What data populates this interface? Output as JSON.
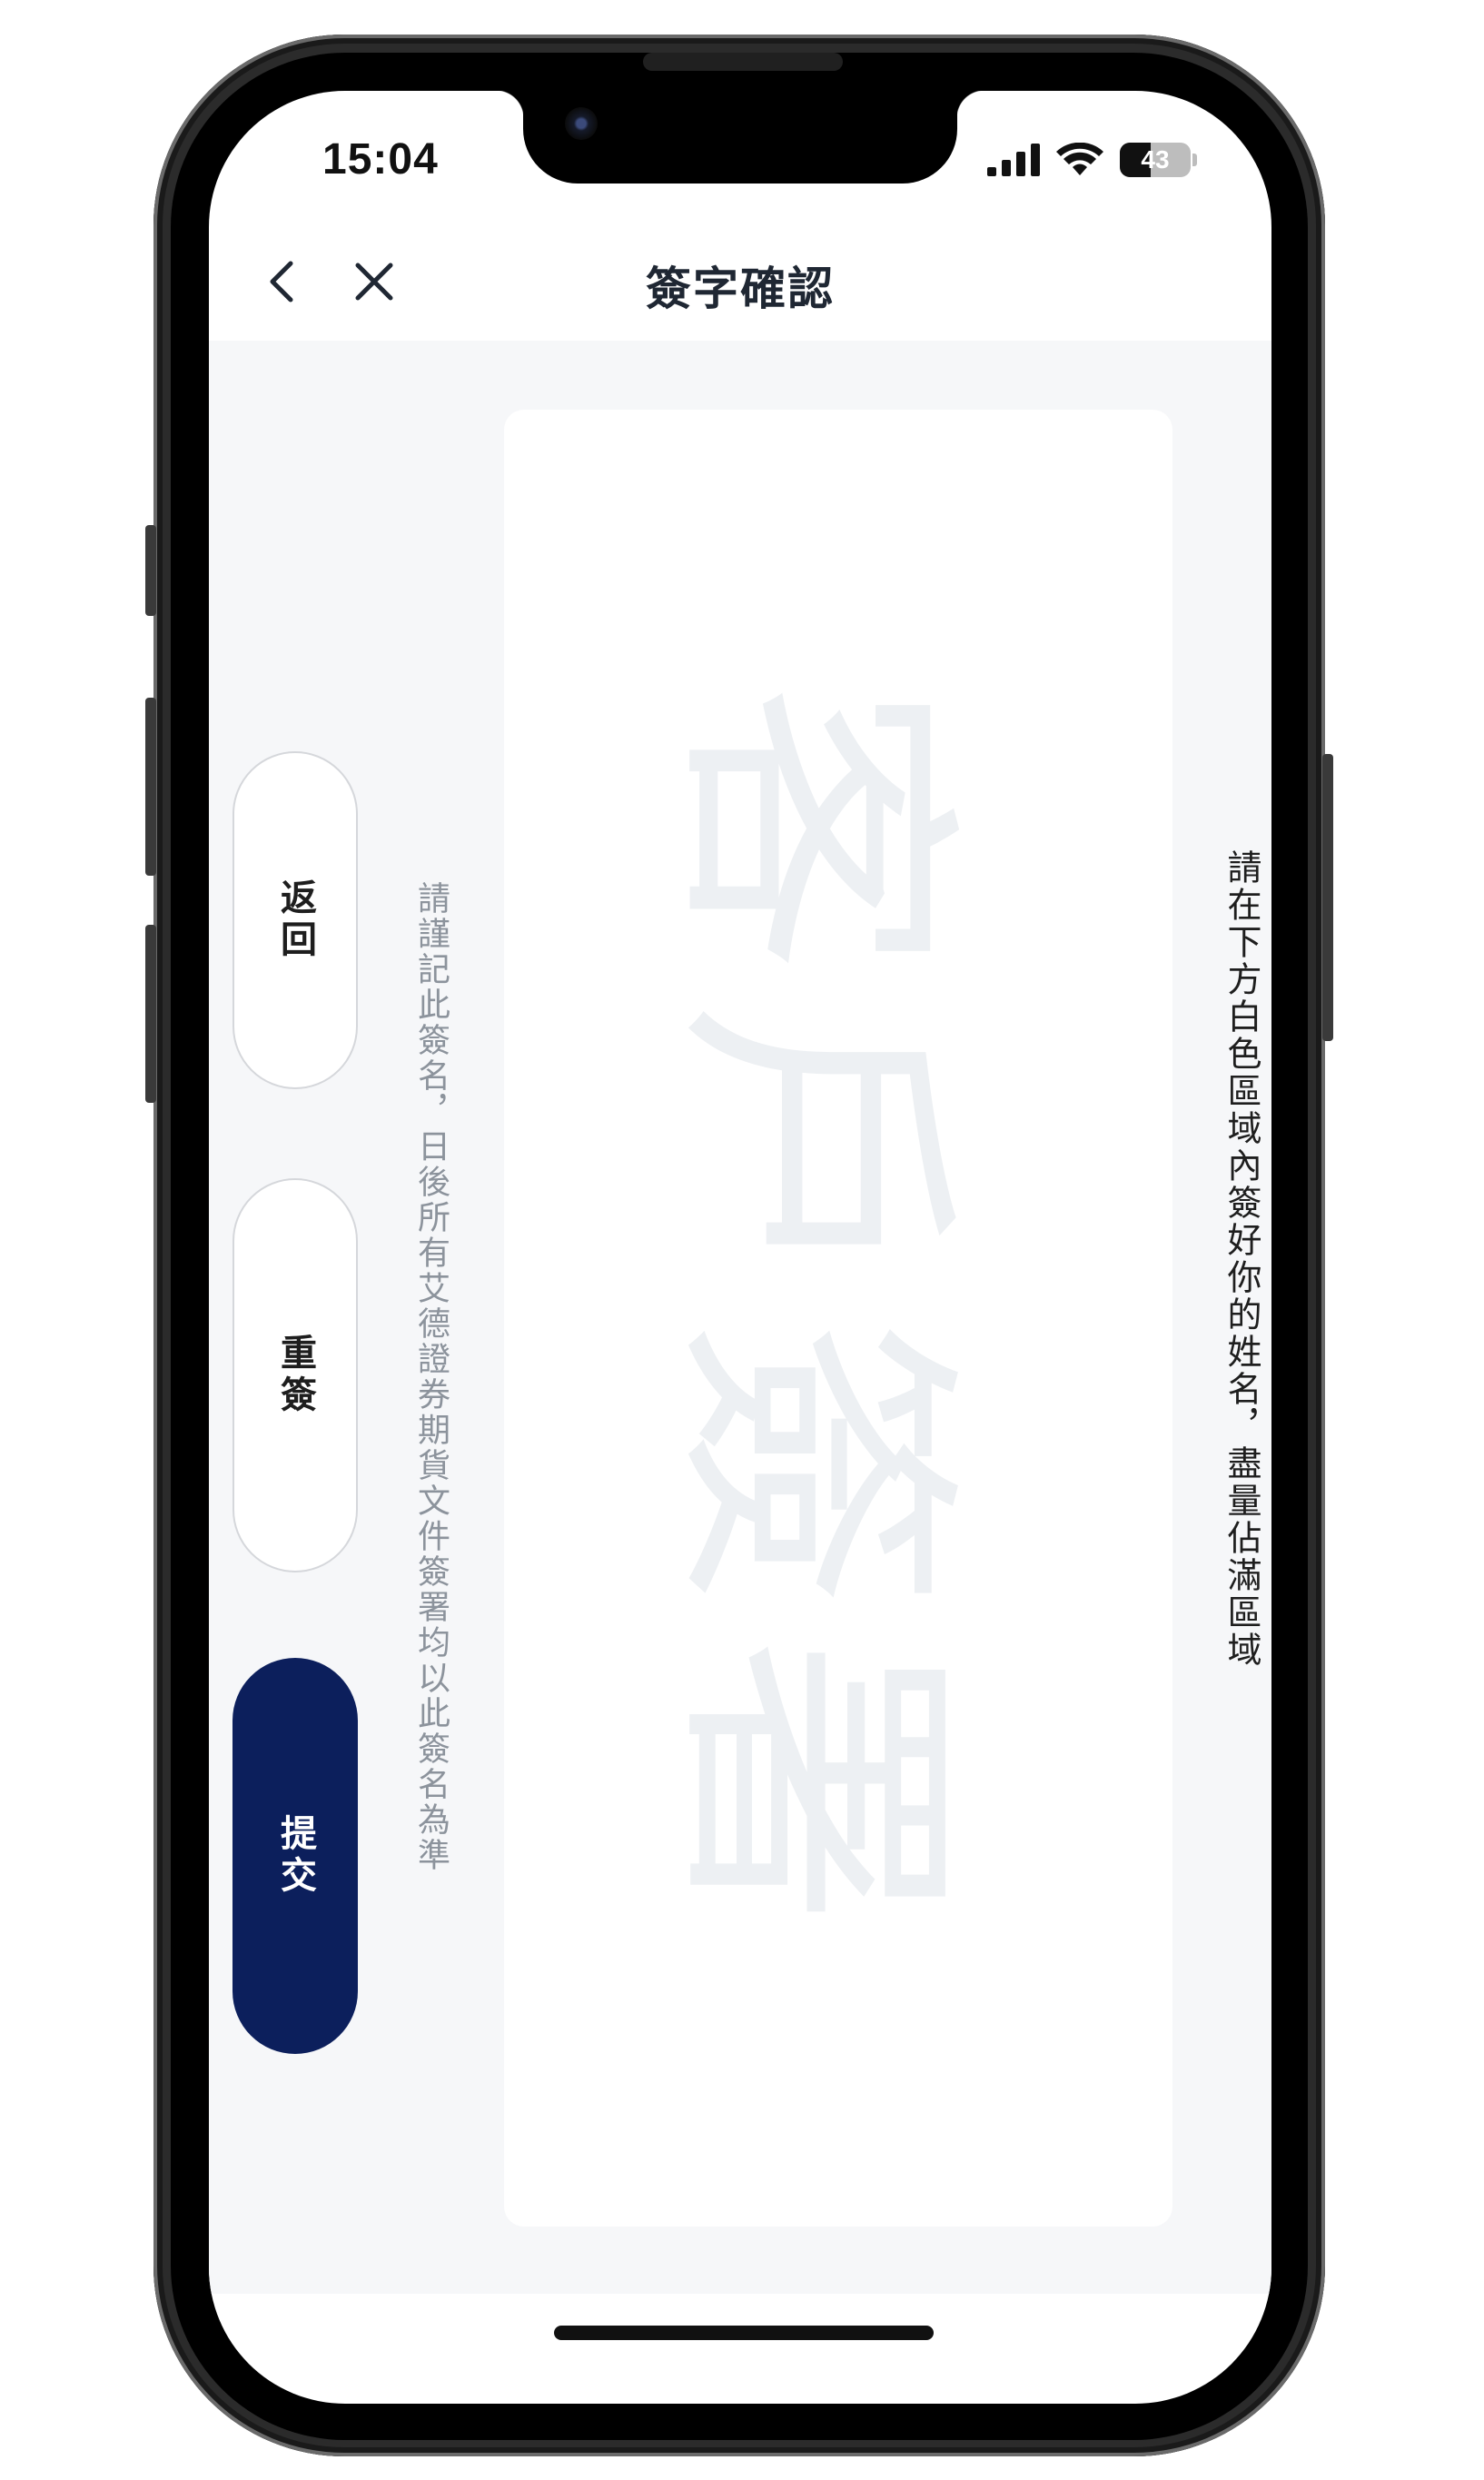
{
  "status_bar": {
    "time": "15:04",
    "battery_level": 43,
    "battery_label": "43"
  },
  "nav": {
    "title": "簽字確認"
  },
  "signature_pad": {
    "watermark": "客戶簽署",
    "instruction": "請在下方白色區域內簽好你的姓名，盡量佔滿區域"
  },
  "note": "請謹記此簽名，日後所有艾德證券期貨文件簽署均以此簽名為準",
  "buttons": {
    "back_label": "返回",
    "resign_label": "重簽",
    "submit_label": "提交"
  },
  "colors": {
    "primary": "#0c1f5c",
    "background": "#f6f7f9",
    "note_text": "#8c939c"
  }
}
